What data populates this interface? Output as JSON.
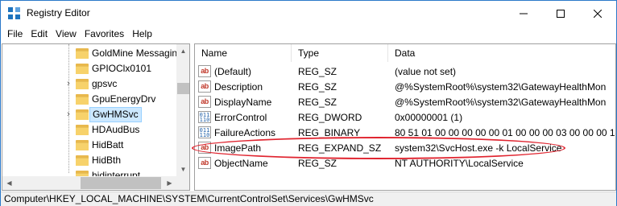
{
  "window": {
    "title": "Registry Editor"
  },
  "menu": [
    "File",
    "Edit",
    "View",
    "Favorites",
    "Help"
  ],
  "tree": {
    "items": [
      {
        "label": "GoldMine Messagin",
        "expandable": false,
        "selected": false
      },
      {
        "label": "GPIOClx0101",
        "expandable": false,
        "selected": false
      },
      {
        "label": "gpsvc",
        "expandable": true,
        "selected": false
      },
      {
        "label": "GpuEnergyDrv",
        "expandable": false,
        "selected": false
      },
      {
        "label": "GwHMSvc",
        "expandable": true,
        "selected": true
      },
      {
        "label": "HDAudBus",
        "expandable": false,
        "selected": false
      },
      {
        "label": "HidBatt",
        "expandable": false,
        "selected": false
      },
      {
        "label": "HidBth",
        "expandable": false,
        "selected": false
      },
      {
        "label": "hidinterrupt",
        "expandable": false,
        "selected": false
      }
    ]
  },
  "list": {
    "headers": {
      "name": "Name",
      "type": "Type",
      "data": "Data"
    },
    "rows": [
      {
        "icon": "string-value-icon",
        "name": "(Default)",
        "type": "REG_SZ",
        "data": "(value not set)"
      },
      {
        "icon": "string-value-icon",
        "name": "Description",
        "type": "REG_SZ",
        "data": "@%SystemRoot%\\system32\\GatewayHealthMon"
      },
      {
        "icon": "string-value-icon",
        "name": "DisplayName",
        "type": "REG_SZ",
        "data": "@%SystemRoot%\\system32\\GatewayHealthMon"
      },
      {
        "icon": "binary-value-icon",
        "name": "ErrorControl",
        "type": "REG_DWORD",
        "data": "0x00000001 (1)"
      },
      {
        "icon": "binary-value-icon",
        "name": "FailureActions",
        "type": "REG_BINARY",
        "data": "80 51 01 00 00 00 00 00 01 00 00 00 03 00 00 00 14 0"
      },
      {
        "icon": "string-value-icon",
        "name": "ImagePath",
        "type": "REG_EXPAND_SZ",
        "data": "system32\\SvcHost.exe -k LocalService"
      },
      {
        "icon": "string-value-icon",
        "name": "ObjectName",
        "type": "REG_SZ",
        "data": "NT AUTHORITY\\LocalService"
      }
    ]
  },
  "statusbar": {
    "path": "Computer\\HKEY_LOCAL_MACHINE\\SYSTEM\\CurrentControlSet\\Services\\GwHMSvc"
  },
  "colors": {
    "accent": "#1e73be",
    "selection": "#cce8ff",
    "highlight_ring": "#e0242f",
    "folder": "#f7d26b"
  }
}
